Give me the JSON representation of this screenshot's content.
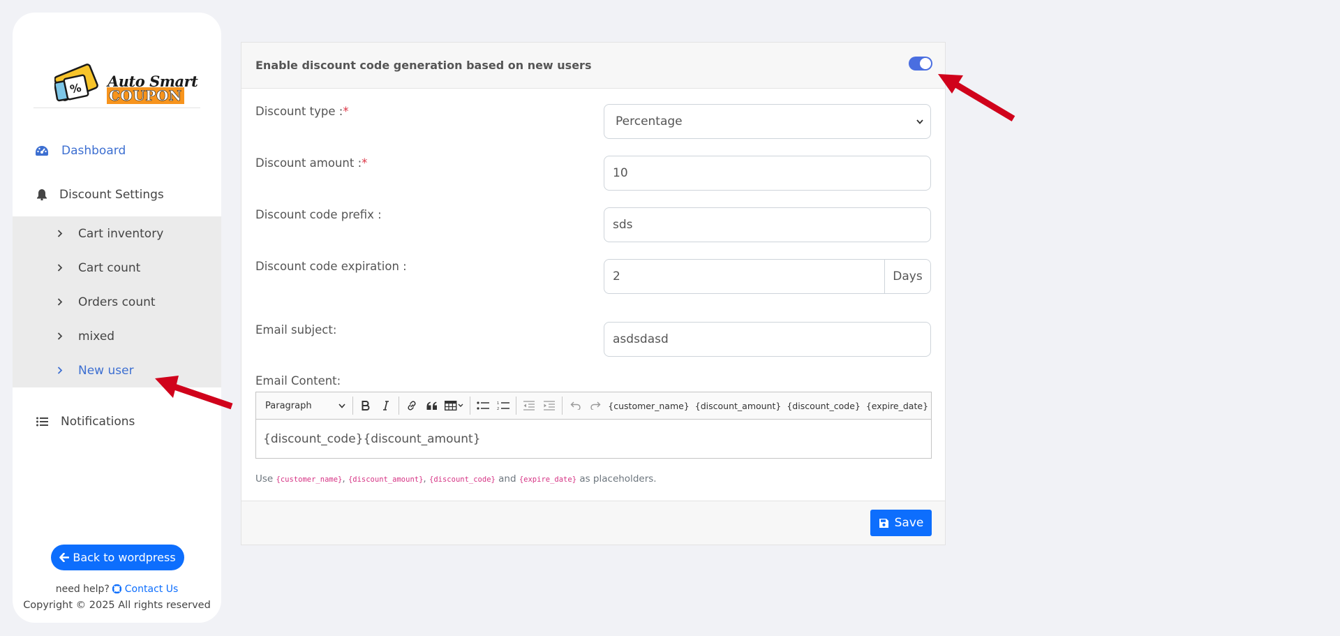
{
  "brand": {
    "logo_line1": "Auto Smart",
    "logo_line2": "COUPON",
    "colors": {
      "accent": "#3d6fd1",
      "primary_button": "#0d6efd",
      "logo_orange": "#f7941d",
      "required": "#dc3545",
      "arrow": "#d0021b"
    }
  },
  "sidebar": {
    "dashboard": {
      "label": "Dashboard",
      "icon": "tachometer-icon"
    },
    "discount_settings": {
      "label": "Discount Settings",
      "icon": "bell-icon"
    },
    "sub_items": [
      {
        "label": "Cart inventory",
        "active": false
      },
      {
        "label": "Cart count",
        "active": false
      },
      {
        "label": "Orders count",
        "active": false
      },
      {
        "label": "mixed",
        "active": false
      },
      {
        "label": "New user",
        "active": true
      }
    ],
    "notifications": {
      "label": "Notifications",
      "icon": "list-icon"
    },
    "back_button": "Back to wordpress",
    "help_prefix": "need help?",
    "help_link": "Contact Us",
    "copyright": "Copyright © 2025 All rights reserved"
  },
  "card": {
    "title": "Enable discount code generation based on new users",
    "toggle_enabled": true,
    "fields": {
      "discount_type": {
        "label": "Discount type :",
        "required": "*",
        "value": "Percentage"
      },
      "discount_amount": {
        "label": "Discount amount :",
        "required": "*",
        "value": "10"
      },
      "code_prefix": {
        "label": "Discount code prefix :",
        "value": "sds"
      },
      "expiration": {
        "label": "Discount code expiration :",
        "value": "2",
        "addon": "Days"
      },
      "email_subject": {
        "label": "Email subject:",
        "value": "asdsdasd"
      }
    },
    "email_content": {
      "label": "Email Content:",
      "heading_select": "Paragraph",
      "placeholders": [
        "{customer_name}",
        "{discount_amount}",
        "{discount_code}",
        "{expire_date}"
      ],
      "body": "{discount_code}{discount_amount}"
    },
    "help": {
      "prefix": "Use",
      "codes": [
        "{customer_name}",
        "{discount_amount}",
        "{discount_code}",
        "{expire_date}"
      ],
      "sep": ",",
      "and": "and",
      "suffix": "as placeholders."
    },
    "save_label": "Save"
  }
}
